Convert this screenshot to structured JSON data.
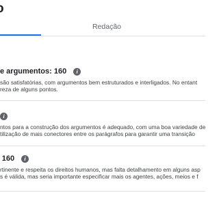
{
  "header": {
    "title": "o"
  },
  "tabs": [
    {
      "label": "Redação"
    }
  ],
  "sections": [
    {
      "heading": "e argumentos: 160",
      "lines": [
        "são satisfatórias, com argumentos bem estruturados e interligados. No entant",
        "reza de alguns pontos."
      ]
    },
    {
      "heading": "",
      "lines": [
        "ntos para a construção dos argumentos é adequado, com uma boa variedade de",
        "tilização de mais conectores entre os parágrafos para garantir uma transição"
      ]
    },
    {
      "heading": ": 160",
      "lines": [
        "rtinente e respeita os direitos humanos, mas falta detalhamento em alguns asp",
        "s é válida, mas seria importante especificar mais os agentes, ações, meios e f"
      ]
    }
  ],
  "icons": {
    "info": "info-icon"
  }
}
